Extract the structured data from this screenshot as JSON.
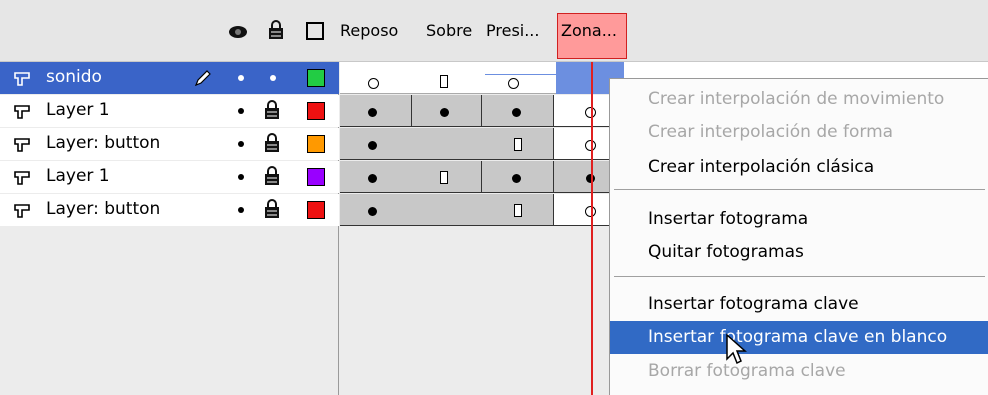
{
  "header": {
    "labels": [
      "Reposo",
      "Sobre",
      "Presi...",
      "Zona..."
    ]
  },
  "layers": [
    {
      "name": "sonido",
      "color": "#22cc44"
    },
    {
      "name": "Layer 1",
      "color": "#ee1111"
    },
    {
      "name": "Layer: button",
      "color": "#ff9900"
    },
    {
      "name": "Layer 1",
      "color": "#9900ff"
    },
    {
      "name": "Layer: button",
      "color": "#ee1111"
    }
  ],
  "context_menu": {
    "items": [
      {
        "label": "Crear interpolación de movimiento",
        "state": "disabled"
      },
      {
        "label": "Crear interpolación de forma",
        "state": "disabled"
      },
      {
        "label": "Crear interpolación clásica",
        "state": "enabled"
      },
      {
        "label": "Insertar fotograma",
        "state": "enabled"
      },
      {
        "label": "Quitar fotogramas",
        "state": "enabled"
      },
      {
        "label": "Insertar fotograma clave",
        "state": "enabled"
      },
      {
        "label": "Insertar fotograma clave en blanco",
        "state": "highlighted"
      },
      {
        "label": "Borrar fotograma clave",
        "state": "disabled"
      }
    ]
  },
  "colors": {
    "selection": "#3a64c8",
    "menu_highlight": "#316ac5",
    "playhead": "#e02020",
    "zone_label_bg": "#ff9a9a"
  },
  "icons": [
    "eye-icon",
    "lock-icon",
    "outline-icon",
    "layer-icon",
    "pencil-icon",
    "cursor-icon"
  ]
}
